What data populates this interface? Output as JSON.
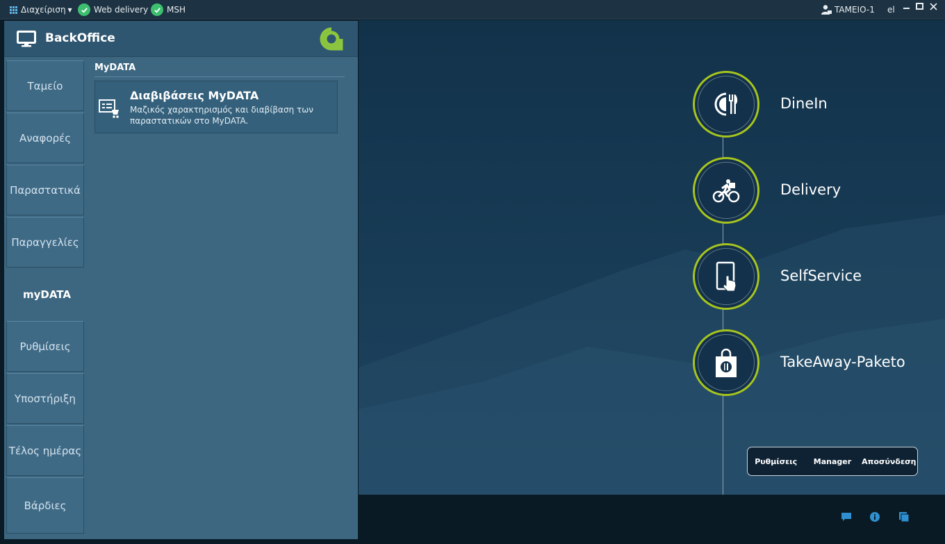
{
  "topbar": {
    "menu_label": "Διαχείριση",
    "status1": "Web delivery",
    "status2": "MSH",
    "user": "TAMEIO-1",
    "lang": "el"
  },
  "panel": {
    "title": "BackOffice",
    "nav": [
      "Ταμείο",
      "Αναφορές",
      "Παραστατικά",
      "Παραγγελίες",
      "myDATA",
      "Ρυθμίσεις",
      "Υποστήριξη",
      "Τέλος ημέρας",
      "Βάρδιες"
    ],
    "active_index": 4,
    "section_title": "MyDATA",
    "card": {
      "title": "Διαβιβάσεις MyDATA",
      "desc": "Μαζικός χαρακτηρισμός και διαβίβαση των παραστατικών στο MyDATA."
    }
  },
  "modes": [
    "DineIn",
    "Delivery",
    "SelfService",
    "TakeAway-Paketo"
  ],
  "buttons": {
    "settings": "Ρυθμίσεις",
    "manager": "Manager",
    "logout": "Αποσύνδεση"
  },
  "colors": {
    "accent": "#a7c51e",
    "status_ok": "#3dbf6f",
    "panel": "#3d6781"
  },
  "icons": [
    "grid-icon",
    "check-icon",
    "user-icon",
    "monitor-icon",
    "brand-logo-icon",
    "invoice-transmit-icon",
    "cutlery-icon",
    "cyclist-icon",
    "touch-tablet-icon",
    "food-bag-icon",
    "chat-icon",
    "info-icon",
    "windows-icon"
  ]
}
